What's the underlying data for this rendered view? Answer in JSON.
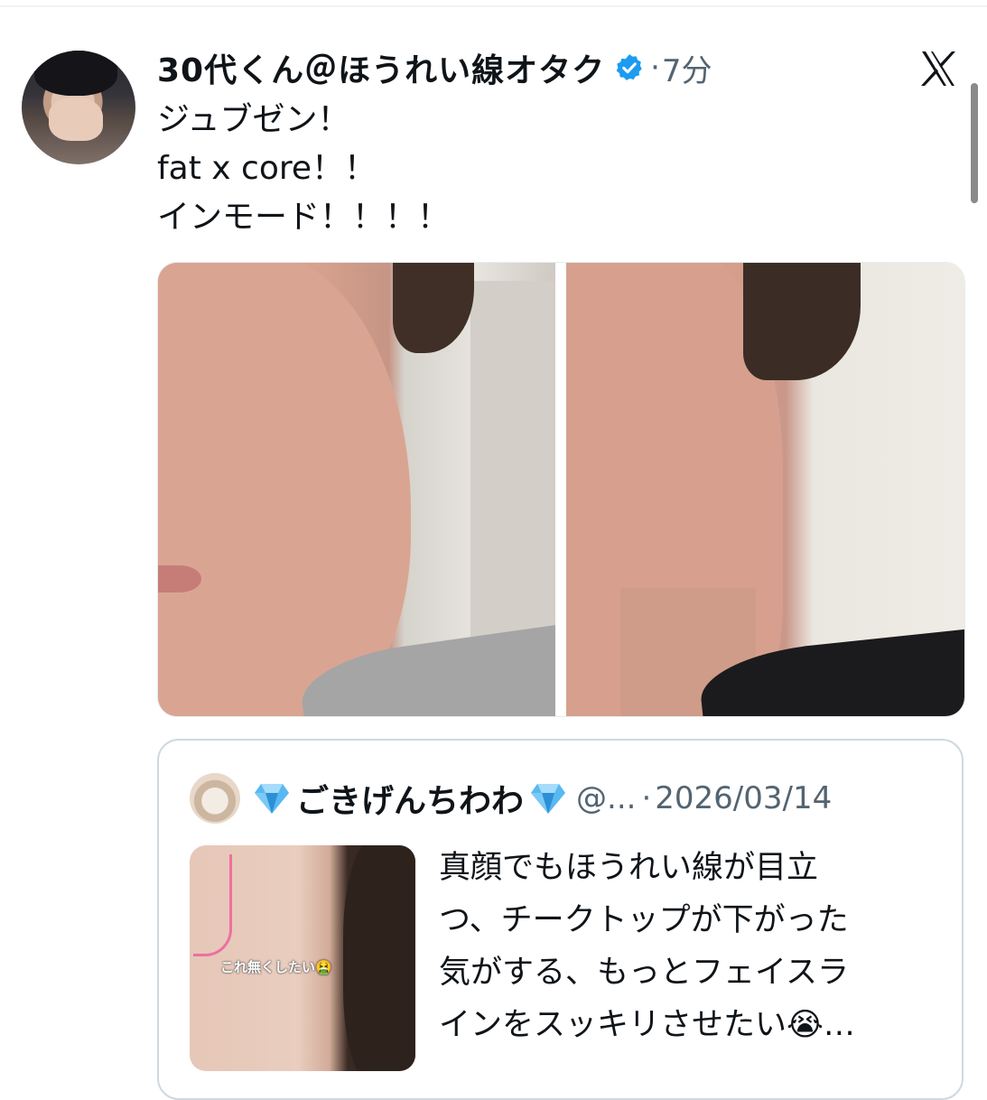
{
  "tweet": {
    "display_name": "30代くん＠ほうれい線オタク",
    "separator": "·",
    "time": "7分",
    "lines": [
      "ジュブゼン！",
      "fat x core！！",
      "インモード！！！！"
    ]
  },
  "quoted": {
    "name": "ごきげんちわわ",
    "handle": "@...",
    "separator": "·",
    "date": "2026/03/14",
    "image_overlay_text": "これ無くしたい🤮",
    "text_lines": [
      "真顔でもほうれい線が目立",
      "つ、チークトップが下がった",
      "気がする、もっとフェイスラ",
      "インをスッキリさせたい😭…"
    ]
  },
  "icons": {
    "verified": "verified-badge-icon",
    "close": "x-logo-icon",
    "gem": "gem-emoji-icon"
  },
  "colors": {
    "verified_blue": "#1d9bf0",
    "secondary_text": "#536471",
    "border": "#cfd9de"
  }
}
